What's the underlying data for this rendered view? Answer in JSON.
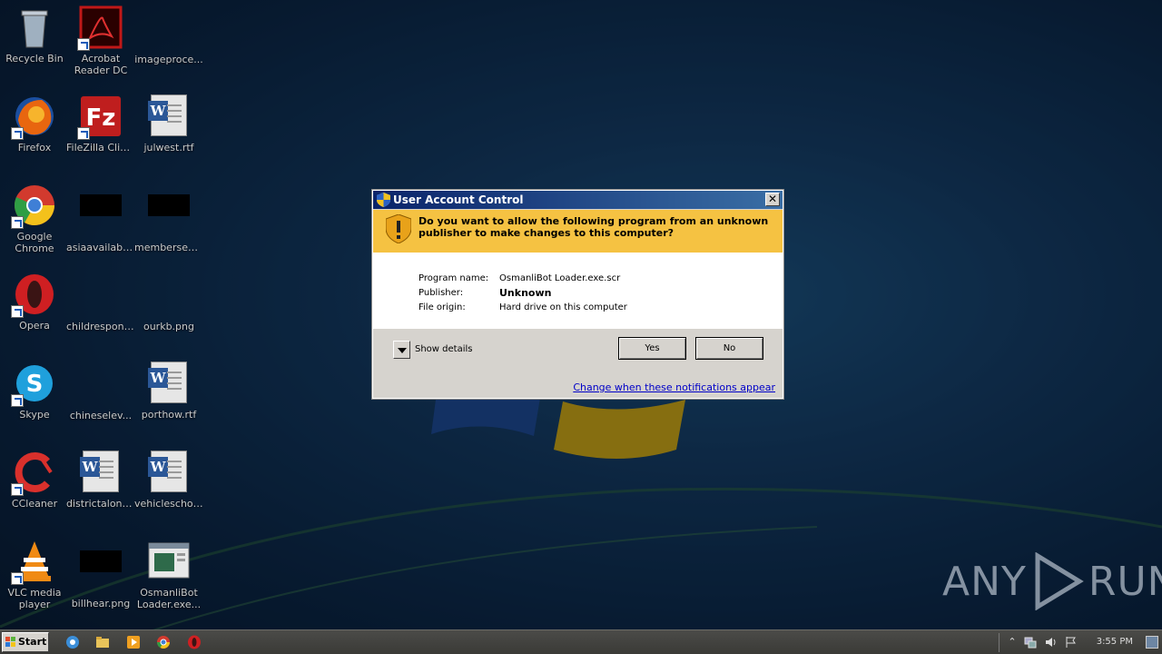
{
  "desktop": {
    "icons": [
      {
        "label": "Recycle Bin",
        "icon": "recycle-bin-icon"
      },
      {
        "label": "Acrobat Reader DC",
        "icon": "acrobat-reader-icon"
      },
      {
        "label": "imageproce...",
        "icon": "blank-file-icon"
      },
      {
        "label": "Firefox",
        "icon": "firefox-icon"
      },
      {
        "label": "FileZilla Client",
        "icon": "filezilla-icon"
      },
      {
        "label": "julwest.rtf",
        "icon": "word-document-icon"
      },
      {
        "label": "Google Chrome",
        "icon": "chrome-icon"
      },
      {
        "label": "asiaavailabil...",
        "icon": "black-image-icon"
      },
      {
        "label": "membersedi...",
        "icon": "black-image-icon"
      },
      {
        "label": "Opera",
        "icon": "opera-icon"
      },
      {
        "label": "childrespons...",
        "icon": "blank-file-icon"
      },
      {
        "label": "ourkb.png",
        "icon": "blank-file-icon"
      },
      {
        "label": "Skype",
        "icon": "skype-icon"
      },
      {
        "label": "chineselev...",
        "icon": "blank-file-icon"
      },
      {
        "label": "porthow.rtf",
        "icon": "word-document-icon"
      },
      {
        "label": "CCleaner",
        "icon": "ccleaner-icon"
      },
      {
        "label": "districtalong...",
        "icon": "word-document-icon"
      },
      {
        "label": "vehicleschoi...",
        "icon": "word-document-icon"
      },
      {
        "label": "VLC media player",
        "icon": "vlc-icon"
      },
      {
        "label": "billhear.png",
        "icon": "black-image-icon"
      },
      {
        "label": "OsmanliBot Loader.exe...",
        "icon": "screensaver-file-icon"
      }
    ]
  },
  "uac": {
    "title": "User Account Control",
    "question": "Do you want to allow the following program from an unknown publisher to make changes to this computer?",
    "program_name_label": "Program name:",
    "program_name_value": "OsmanliBot Loader.exe.scr",
    "publisher_label": "Publisher:",
    "publisher_value": "Unknown",
    "file_origin_label": "File origin:",
    "file_origin_value": "Hard drive on this computer",
    "show_details_label": "Show details",
    "yes_label": "Yes",
    "no_label": "No",
    "change_link": "Change when these notifications appear",
    "banner_color": "#f5c242"
  },
  "watermark": {
    "left": "ANY",
    "right": "RUN"
  },
  "taskbar": {
    "start_label": "Start",
    "clock": "3:55 PM"
  }
}
